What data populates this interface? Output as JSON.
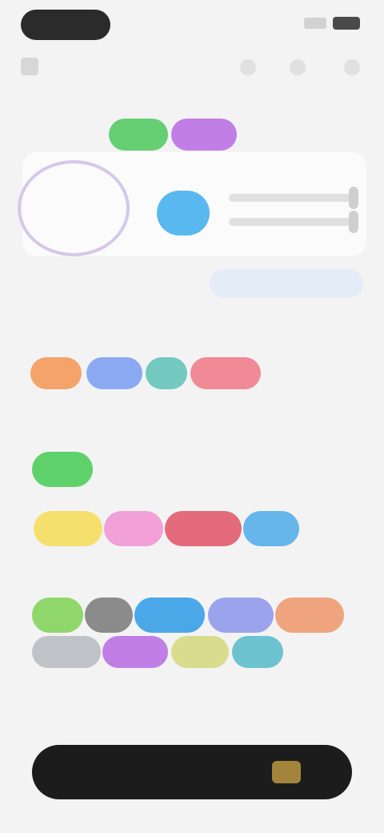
{
  "status": {
    "time_pill": "",
    "signal": "",
    "battery": ""
  },
  "header": {
    "title": "",
    "back": "",
    "actions": [
      "",
      "",
      ""
    ]
  },
  "section_top": {
    "label": "",
    "pills": [
      {
        "label": "",
        "color": "#67cf73"
      },
      {
        "label": "",
        "color": "#c07ee6"
      }
    ]
  },
  "preview": {
    "ring_value": "",
    "small_label": "",
    "blue_button": {
      "label": "",
      "color": "#59b8f0"
    },
    "slider_1": "",
    "slider_2": ""
  },
  "tabs": [
    {
      "label": ""
    },
    {
      "label": ""
    },
    {
      "label": ""
    }
  ],
  "section_1": {
    "label": "",
    "chips": [
      {
        "label": "",
        "color": "#f4a46b"
      },
      {
        "label": "",
        "color": "#8aa9f2"
      },
      {
        "label": "",
        "color": "#73c9bf"
      },
      {
        "label": "",
        "color": "#f08a96"
      }
    ]
  },
  "section_2": {
    "label": "",
    "subtitle": "",
    "chips": [
      {
        "label": "",
        "color": "#5ed16b"
      },
      {
        "label": "",
        "color": "#f5e06d"
      },
      {
        "label": "",
        "color": "#f1a1d7"
      },
      {
        "label": "",
        "color": "#e36b7b"
      },
      {
        "label": "",
        "color": "#66b6ec"
      }
    ]
  },
  "section_3": {
    "label": "",
    "chips": [
      {
        "label": "",
        "color": "#8fd76a"
      },
      {
        "label": "",
        "color": "#8b8b8b"
      },
      {
        "label": "",
        "color": "#4aa7e8"
      },
      {
        "label": "",
        "color": "#9aa3eb"
      },
      {
        "label": "",
        "color": "#f0a47e"
      },
      {
        "label": "",
        "color": "#bfc2c7"
      },
      {
        "label": "",
        "color": "#c07ee6"
      },
      {
        "label": "",
        "color": "#d8dc8c"
      },
      {
        "label": "",
        "color": "#6cc2cf"
      }
    ]
  },
  "cta": {
    "label": "",
    "accent": "#c4a042"
  }
}
